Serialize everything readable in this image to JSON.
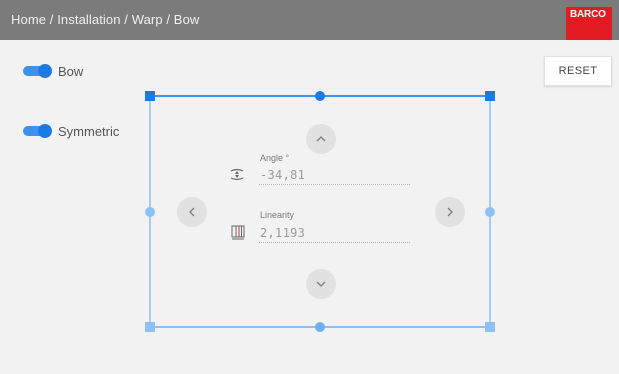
{
  "header": {
    "breadcrumb": "Home / Installation / Warp / Bow",
    "logo_text": "BARCO"
  },
  "toggles": [
    {
      "label": "Bow",
      "on": true
    },
    {
      "label": "Symmetric",
      "on": true
    }
  ],
  "reset_label": "RESET",
  "fields": {
    "angle": {
      "label": "Angle °",
      "value": "-34,81",
      "icon": "angle-icon"
    },
    "linearity": {
      "label": "Linearity",
      "value": "2,1193",
      "icon": "linearity-icon"
    }
  },
  "nav_buttons": {
    "up": "chevron-up-icon",
    "down": "chevron-down-icon",
    "left": "chevron-left-icon",
    "right": "chevron-right-icon"
  },
  "colors": {
    "header_bg": "#7b7b7b",
    "logo_bg": "#e31b23",
    "accent_blue": "#1a7ae6",
    "frame_line": "#3d96f0",
    "frame_light": "#8cc1f5"
  }
}
